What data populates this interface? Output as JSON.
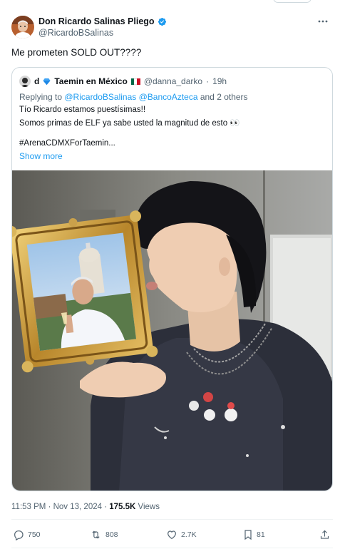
{
  "tweet": {
    "author": {
      "display_name": "Don Ricardo Salinas Pliego",
      "handle": "@RicardoBSalinas",
      "verified": true,
      "avatar_icon": "author-avatar"
    },
    "text": "Me prometen SOLD OUT????",
    "quote": {
      "name_prefix": "d",
      "name": "Taemin en México",
      "handle": "@danna_darko",
      "separator": "·",
      "time": "19h",
      "replying_prefix": "Replying to ",
      "replying_mentions": "@RicardoBSalinas @BancoAzteca",
      "replying_suffix": " and 2 others",
      "lines": [
        "Tío Ricardo estamos puestísimas!!",
        "Somos primas de ELF ya sabe usted la magnitud de esto 👀",
        "#ArenaCDMXForTaemin..."
      ],
      "show_more": "Show more",
      "media_icon": "photo-taemin-holding-framed-portrait"
    },
    "meta": {
      "time": "11:53 PM · Nov 13, 2024",
      "separator": " · ",
      "views_count": "175.5K",
      "views_label": " Views"
    },
    "actions": {
      "replies": "750",
      "reposts": "808",
      "likes": "2.7K",
      "bookmarks": "81"
    },
    "colors": {
      "accent": "#1d9bf0",
      "text": "#0f1419",
      "secondary": "#536471",
      "border": "#cfd9de"
    }
  }
}
